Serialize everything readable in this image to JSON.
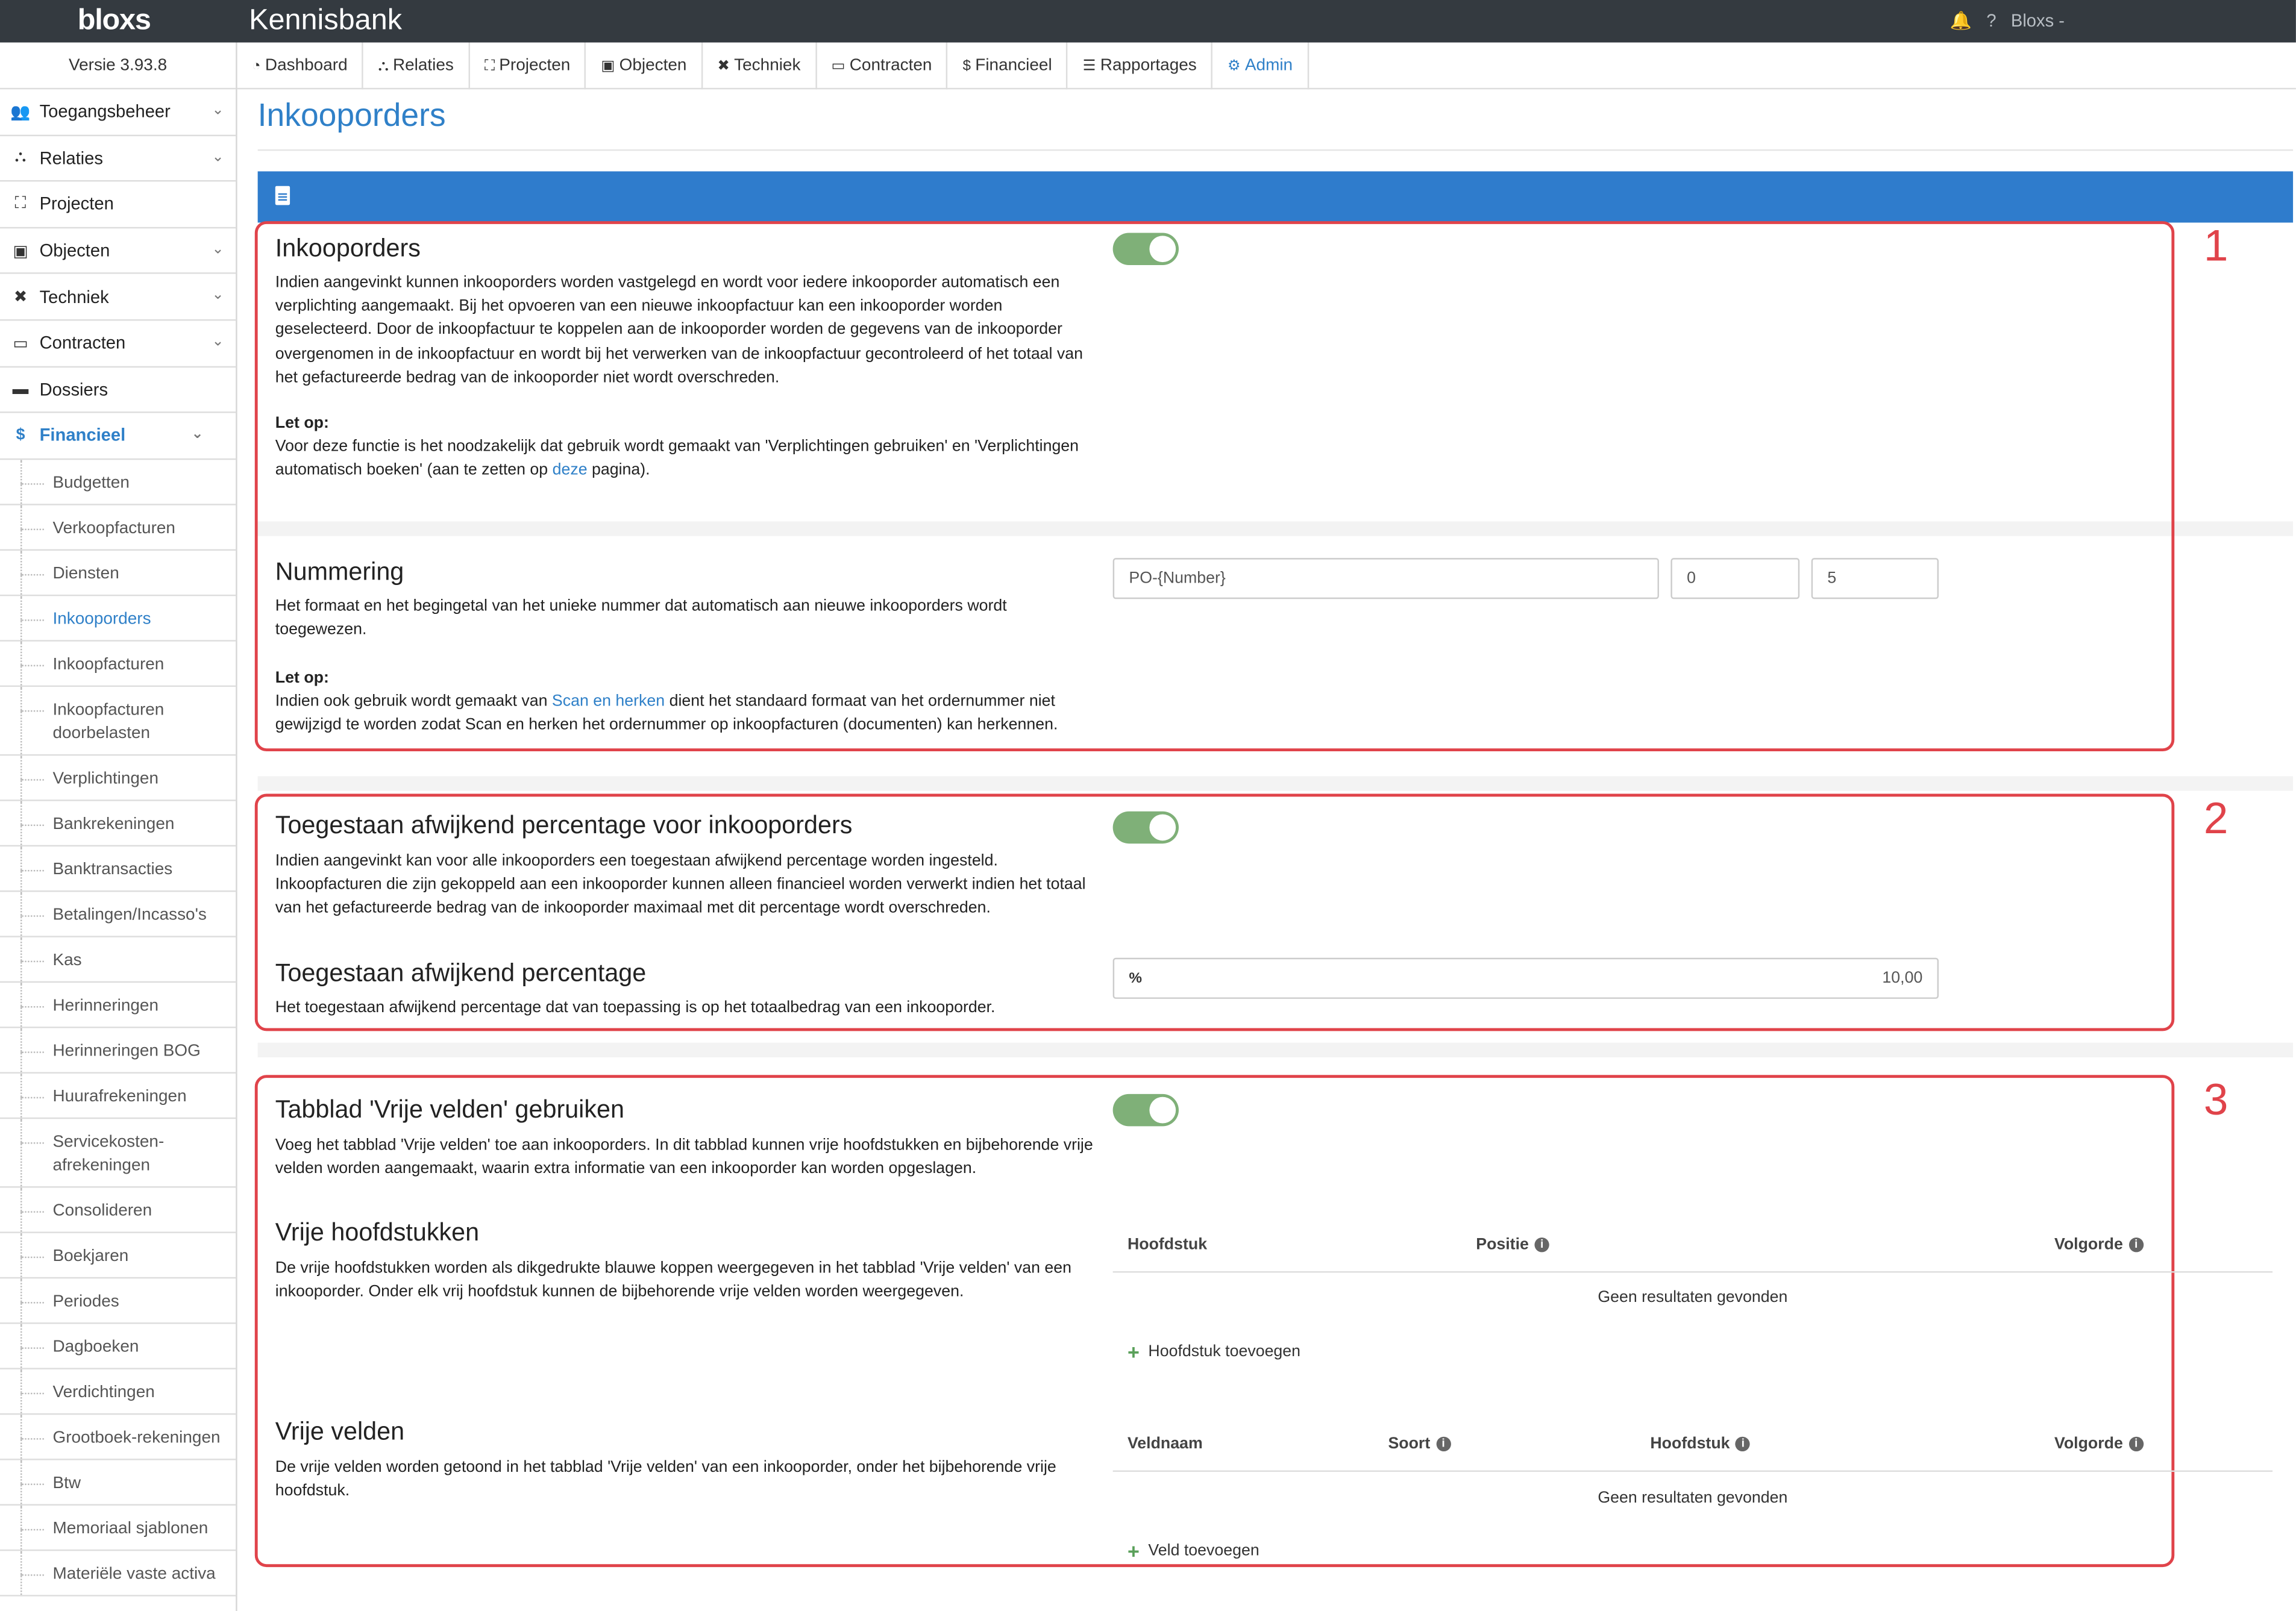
{
  "topbar": {
    "brand": "bloxs",
    "app_title": "Kennisbank",
    "bell_icon": "bell-icon",
    "help_icon": "question-icon",
    "user": "Bloxs -"
  },
  "sidebar": {
    "version": "Versie 3.93.8",
    "items": [
      {
        "label": "Toegangsbeheer",
        "icon": "users-icon",
        "expandable": true
      },
      {
        "label": "Relaties",
        "icon": "sitemap-icon",
        "expandable": true
      },
      {
        "label": "Projecten",
        "icon": "expand-icon",
        "expandable": false
      },
      {
        "label": "Objecten",
        "icon": "image-icon",
        "expandable": true
      },
      {
        "label": "Techniek",
        "icon": "tools-icon",
        "expandable": true
      },
      {
        "label": "Contracten",
        "icon": "folder-icon",
        "expandable": true
      },
      {
        "label": "Dossiers",
        "icon": "archive-icon",
        "expandable": false
      },
      {
        "label": "Financieel",
        "icon": "dollar-icon",
        "expandable": true,
        "active": true
      }
    ],
    "sub_items": [
      "Budgetten",
      "Verkoopfacturen",
      "Diensten",
      "Inkooporders",
      "Inkoopfacturen",
      "Inkoopfacturen doorbelasten",
      "Verplichtingen",
      "Bankrekeningen",
      "Banktransacties",
      "Betalingen/Incasso's",
      "Kas",
      "Herinneringen",
      "Herinneringen BOG",
      "Huurafrekeningen",
      "Servicekosten-afrekeningen",
      "Consolideren",
      "Boekjaren",
      "Periodes",
      "Dagboeken",
      "Verdichtingen",
      "Grootboek-rekeningen",
      "Btw",
      "Memoriaal sjablonen",
      "Materiële vaste activa"
    ],
    "active_sub": "Inkooporders"
  },
  "nav": {
    "tabs": [
      {
        "label": "Dashboard",
        "icon": "dashboard-icon"
      },
      {
        "label": "Relaties",
        "icon": "sitemap-icon"
      },
      {
        "label": "Projecten",
        "icon": "expand-icon"
      },
      {
        "label": "Objecten",
        "icon": "image-icon"
      },
      {
        "label": "Techniek",
        "icon": "tools-icon"
      },
      {
        "label": "Contracten",
        "icon": "folder-icon"
      },
      {
        "label": "Financieel",
        "icon": "dollar-icon"
      },
      {
        "label": "Rapportages",
        "icon": "list-icon"
      },
      {
        "label": "Admin",
        "icon": "gear-icon",
        "active": true
      }
    ]
  },
  "page": {
    "title": "Inkooporders"
  },
  "colors": {
    "accent": "#2f80c8",
    "header_bar": "#2f7ccc",
    "toggle_on": "#7fb078",
    "highlight": "#e0434a",
    "topbar": "#343a40"
  },
  "annotations": [
    "1",
    "2",
    "3"
  ],
  "sections": {
    "inkooporders": {
      "title": "Inkooporders",
      "enabled": true,
      "description": "Indien aangevinkt kunnen inkooporders worden vastgelegd en wordt voor iedere inkooporder automatisch een verplichting aangemaakt. Bij het opvoeren van een nieuwe inkoopfactuur kan een inkooporder worden geselecteerd. Door de inkoopfactuur te koppelen aan de inkooporder worden de gegevens van de inkooporder overgenomen in de inkoopfactuur en wordt bij het verwerken van de inkoopfactuur gecontroleerd of het totaal van het gefactureerde bedrag van de inkooporder niet wordt overschreden.",
      "note_label": "Let op:",
      "note_before": "Voor deze functie is het noodzakelijk dat gebruik wordt gemaakt van 'Verplichtingen gebruiken' en 'Verplichtingen automatisch boeken' (aan te zetten op ",
      "note_link": "deze",
      "note_after": " pagina)."
    },
    "nummering": {
      "title": "Nummering",
      "description": "Het formaat en het begingetal van het unieke nummer dat automatisch aan nieuwe inkooporders wordt toegewezen.",
      "note_label": "Let op:",
      "note_before": "Indien ook gebruik wordt gemaakt van ",
      "note_link": "Scan en herken",
      "note_after": " dient het standaard formaat van het ordernummer niet gewijzigd te worden zodat Scan en herken het ordernummer op inkoopfacturen (documenten) kan herkennen.",
      "format_value": "PO-{Number}",
      "start_value": "0",
      "length_value": "5"
    },
    "afwijkend_toggle": {
      "title": "Toegestaan afwijkend percentage voor inkooporders",
      "enabled": true,
      "description": "Indien aangevinkt kan voor alle inkooporders een toegestaan afwijkend percentage worden ingesteld. Inkoopfacturen die zijn gekoppeld aan een inkooporder kunnen alleen financieel worden verwerkt indien het totaal van het gefactureerde bedrag van de inkooporder maximaal met dit percentage wordt overschreden."
    },
    "afwijkend_pct": {
      "title": "Toegestaan afwijkend percentage",
      "description": "Het toegestaan afwijkend percentage dat van toepassing is op het totaalbedrag van een inkooporder.",
      "prefix_icon": "percent-icon",
      "value": "10,00"
    },
    "vrije_velden_tab": {
      "title": "Tabblad 'Vrije velden' gebruiken",
      "enabled": true,
      "description": "Voeg het tabblad 'Vrije velden' toe aan inkooporders. In dit tabblad kunnen vrije hoofdstukken en bijbehorende vrije velden worden aangemaakt, waarin extra informatie van een inkooporder kan worden opgeslagen."
    },
    "vrije_hoofdstukken": {
      "title": "Vrije hoofdstukken",
      "description": "De vrije hoofdstukken worden als dikgedrukte blauwe koppen weergegeven in het tabblad 'Vrije velden' van een inkooporder. Onder elk vrij hoofdstuk kunnen de bijbehorende vrije velden worden weergegeven.",
      "columns": [
        "Hoofdstuk",
        "Positie",
        "Volgorde"
      ],
      "empty": "Geen resultaten gevonden",
      "add_label": "Hoofdstuk toevoegen"
    },
    "vrije_velden": {
      "title": "Vrije velden",
      "description": "De vrije velden worden getoond in het tabblad 'Vrije velden' van een inkooporder, onder het bijbehorende vrije hoofdstuk.",
      "columns": [
        "Veldnaam",
        "Soort",
        "Hoofdstuk",
        "Volgorde"
      ],
      "empty": "Geen resultaten gevonden",
      "add_label": "Veld toevoegen"
    }
  }
}
